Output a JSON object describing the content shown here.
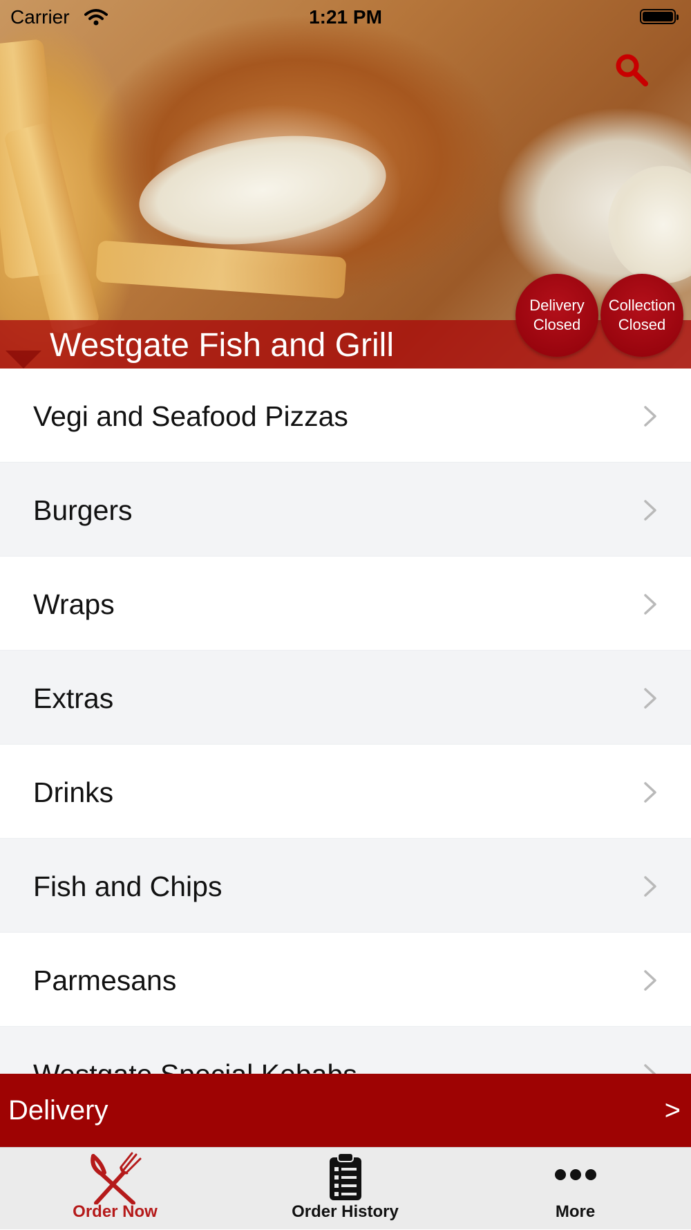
{
  "status_bar": {
    "carrier": "Carrier",
    "time": "1:21 PM"
  },
  "header": {
    "title": "Westgate Fish and Grill",
    "delivery_status": {
      "line1": "Delivery",
      "line2": "Closed"
    },
    "collection_status": {
      "line1": "Collection",
      "line2": "Closed"
    }
  },
  "menu": {
    "items": [
      {
        "label": "Vegi and Seafood Pizzas"
      },
      {
        "label": "Burgers"
      },
      {
        "label": "Wraps"
      },
      {
        "label": "Extras"
      },
      {
        "label": "Drinks"
      },
      {
        "label": "Fish and Chips"
      },
      {
        "label": "Parmesans"
      },
      {
        "label": "Westgate Special Kebabs"
      }
    ]
  },
  "delivery_bar": {
    "label": "Delivery",
    "arrow": ">"
  },
  "tab_bar": {
    "tabs": [
      {
        "label": "Order Now",
        "icon": "fork-knife-icon",
        "active": true
      },
      {
        "label": "Order History",
        "icon": "clipboard-list-icon",
        "active": false
      },
      {
        "label": "More",
        "icon": "more-dots-icon",
        "active": false
      }
    ]
  },
  "colors": {
    "brand_red": "#9e0303",
    "active_tab": "#b51a1a",
    "inactive_tab": "#111111",
    "row_alt": "#f3f4f6"
  }
}
